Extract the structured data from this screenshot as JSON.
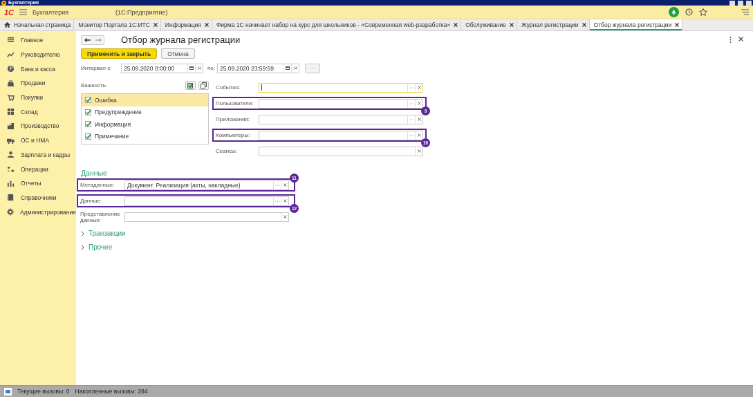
{
  "title_bar": {
    "title": "Бухгалтерия"
  },
  "header": {
    "logo": "1С",
    "app_name": "Бухгалтерия",
    "platform": "(1С:Предприятие)"
  },
  "tabs": [
    {
      "label": "Начальная страница",
      "kind": "home",
      "selected": false
    },
    {
      "label": "Монитор Портала 1С:ИТС",
      "kind": "page",
      "selected": false
    },
    {
      "label": "Информация",
      "kind": "page",
      "selected": false
    },
    {
      "label": "Фирма 1С начинает набор на курс для школьников - «Современная web-разработка»",
      "kind": "page",
      "selected": false
    },
    {
      "label": "Обслуживание",
      "kind": "page",
      "selected": false
    },
    {
      "label": "Журнал регистрации",
      "kind": "page",
      "selected": false
    },
    {
      "label": "Отбор журнала регистрации",
      "kind": "page",
      "selected": true
    }
  ],
  "sidebar": {
    "items": [
      {
        "label": "Главное"
      },
      {
        "label": "Руководителю"
      },
      {
        "label": "Банк и касса"
      },
      {
        "label": "Продажи"
      },
      {
        "label": "Покупки"
      },
      {
        "label": "Склад"
      },
      {
        "label": "Производство"
      },
      {
        "label": "ОС и НМА"
      },
      {
        "label": "Зарплата и кадры"
      },
      {
        "label": "Операции"
      },
      {
        "label": "Отчеты"
      },
      {
        "label": "Справочники"
      },
      {
        "label": "Администрирование"
      }
    ]
  },
  "form": {
    "title": "Отбор журнала регистрации",
    "buttons": [
      {
        "label": "Применить и закрыть",
        "kind": "primary"
      },
      {
        "label": "Отмена",
        "kind": "normal"
      }
    ],
    "interval": {
      "label": "Интервал с:",
      "from": "25.09.2020  0:00:00",
      "to_label": "по:",
      "to": "25.09.2020 23:59:59"
    },
    "importance": {
      "label": "Важность:",
      "items": [
        {
          "label": "Ошибка",
          "checked": true,
          "selected": true
        },
        {
          "label": "Предупреждение",
          "checked": true,
          "selected": false
        },
        {
          "label": "Информация",
          "checked": true,
          "selected": false
        },
        {
          "label": "Примечание",
          "checked": true,
          "selected": false
        }
      ]
    },
    "filters": [
      {
        "label": "События:",
        "kind": "select",
        "focused": true
      },
      {
        "label": "Пользователи:",
        "kind": "select",
        "focused": false,
        "annotation": "9"
      },
      {
        "label": "Приложения:",
        "kind": "select",
        "focused": false
      },
      {
        "label": "Компьютеры:",
        "kind": "select",
        "focused": false,
        "annotation": "10"
      },
      {
        "label": "Сеансы:",
        "kind": "clear",
        "focused": false
      }
    ],
    "data_section": {
      "heading": "Данные",
      "fields": [
        {
          "label": "Метаданные:",
          "kind": "select",
          "value": "Документ. Реализация (акты, накладные)",
          "annotation": "11"
        },
        {
          "label": "Данные:",
          "kind": "select",
          "annotation": "12"
        },
        {
          "label": "Представление данных:",
          "kind": "clear"
        }
      ]
    },
    "groups": [
      {
        "label": "Транзакции",
        "expanded": false
      },
      {
        "label": "Прочее",
        "expanded": false
      }
    ]
  },
  "status_bar": {
    "current_calls": "Текущие вызовы: 0",
    "accumulated_calls": "Накопленные вызовы: 284"
  }
}
